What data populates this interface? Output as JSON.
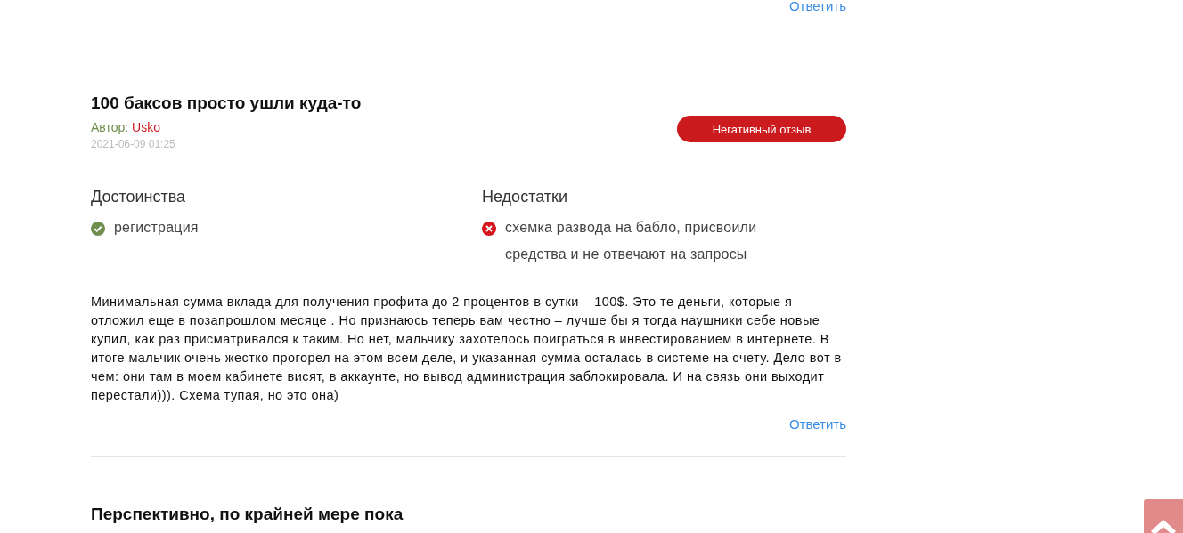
{
  "top_reply_link": "Ответить",
  "reviews": [
    {
      "title": "100 баксов просто ушли куда-то",
      "author_label": "Автор:",
      "author": "Usko",
      "date": "2021-06-09 01:25",
      "badge": {
        "label": "Негативный отзыв",
        "kind": "negative"
      },
      "pros_heading": "Достоинства",
      "pros": [
        "регистрация"
      ],
      "cons_heading": "Недостатки",
      "cons": [
        "схемка развода на бабло, присвоили средства и не отвечают на запросы"
      ],
      "text": "Минимальная сумма вклада для получения профита до 2 процентов в сутки – 100$. Это те деньги, которые я отложил еще в позапрошлом месяце . Но признаюсь теперь вам честно – лучше бы я тогда наушники себе новые купил, как раз присматривался к таким. Но нет, мальчику захотелось поиграться в инвестированием в интернете. В итоге мальчик очень жестко прогорел на этом всем деле, и указанная сумма осталась в системе на счету. Дело вот в чем: они там в моем кабинете висят, в аккаунте, но вывод администрация заблокировала. И на связь они выходит перестали))). Схема тупая, но это она)",
      "reply": "Ответить"
    }
  ],
  "next_review_title": "Перспективно, по крайней мере пока"
}
